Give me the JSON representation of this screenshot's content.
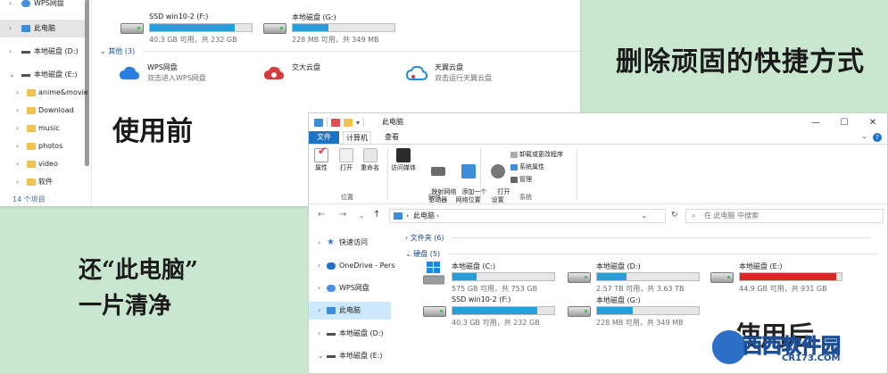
{
  "captions": {
    "title": "删除顽固的快捷方式",
    "before": "使用前",
    "after_line1": "还“此电脑”",
    "after_line2": "一片清净",
    "after": "使用后"
  },
  "before_window": {
    "nav": [
      {
        "label": "WPS网盘",
        "icon": "wps-cloud-icon"
      },
      {
        "label": "此电脑",
        "icon": "pc-icon",
        "selected": true
      },
      {
        "label": "本地磁盘 (D:)",
        "icon": "drive-icon"
      },
      {
        "label": "本地磁盘 (E:)",
        "icon": "drive-icon",
        "expanded": true
      },
      {
        "label": "anime&movie",
        "icon": "folder-icon"
      },
      {
        "label": "Download",
        "icon": "folder-icon"
      },
      {
        "label": "music",
        "icon": "folder-icon"
      },
      {
        "label": "photos",
        "icon": "folder-icon"
      },
      {
        "label": "video",
        "icon": "folder-icon"
      },
      {
        "label": "软件",
        "icon": "folder-icon"
      }
    ],
    "status": "14 个项目",
    "drives": [
      {
        "name": "SSD win10-2 (F:)",
        "info": "40.3 GB 可用，共 232 GB",
        "used_fraction": 0.83
      },
      {
        "name": "本地磁盘 (G:)",
        "info": "228 MB 可用，共 349 MB",
        "used_fraction": 0.35
      }
    ],
    "others_header": "其他 (3)",
    "others": [
      {
        "name": "WPS网盘",
        "desc": "双击进入WPS网盘",
        "icon": "wps-cloud-icon"
      },
      {
        "name": "交大云盘",
        "desc": "",
        "icon": "jd-cloud-icon"
      },
      {
        "name": "天翼云盘",
        "desc": "双击运行天翼云盘",
        "icon": "tianyi-cloud-icon"
      }
    ]
  },
  "after_window": {
    "title": "此电脑",
    "tabs": {
      "file": "文件",
      "computer": "计算机",
      "view": "查看"
    },
    "ribbon": {
      "properties": "属性",
      "open": "打开",
      "rename": "重命名",
      "access_media": "访问媒体",
      "map_drive": "映射网络\n驱动器",
      "add_location": "添加一个\n网络位置",
      "open_settings": "打开\n设置",
      "uninstall": "卸载或更改程序",
      "system_props": "系统属性",
      "manage": "管理",
      "group_location": "位置",
      "group_network": "网络",
      "group_system": "系统"
    },
    "address": {
      "path": "此电脑",
      "chevron": "›"
    },
    "search_placeholder": "在 此电脑 中搜索",
    "tree": [
      {
        "label": "快速访问",
        "icon": "star-icon"
      },
      {
        "label": "OneDrive - Pers",
        "icon": "onedrive-icon"
      },
      {
        "label": "WPS网盘",
        "icon": "wps-cloud-icon"
      },
      {
        "label": "此电脑",
        "icon": "pc-icon",
        "selected": true
      },
      {
        "label": "本地磁盘 (D:)",
        "icon": "drive-icon"
      },
      {
        "label": "本地磁盘 (E:)",
        "icon": "drive-icon"
      }
    ],
    "folders_header": "文件夹 (6)",
    "drives_header": "硬盘 (5)",
    "drives": [
      {
        "name": "本地磁盘 (C:)",
        "info": "575 GB 可用，共 753 GB",
        "used_fraction": 0.24,
        "color": "#26a0da"
      },
      {
        "name": "本地磁盘 (D:)",
        "info": "2.57 TB 可用，共 3.63 TB",
        "used_fraction": 0.29,
        "color": "#26a0da"
      },
      {
        "name": "本地磁盘 (E:)",
        "info": "44.9 GB 可用，共 931 GB",
        "used_fraction": 0.95,
        "color": "#da2626"
      },
      {
        "name": "SSD win10-2 (F:)",
        "info": "40.3 GB 可用，共 232 GB",
        "used_fraction": 0.83,
        "color": "#26a0da"
      },
      {
        "name": "本地磁盘 (G:)",
        "info": "228 MB 可用，共 349 MB",
        "used_fraction": 0.35,
        "color": "#26a0da"
      }
    ]
  },
  "watermark": {
    "brand": "西西软件园",
    "domain": "CR173.COM"
  }
}
